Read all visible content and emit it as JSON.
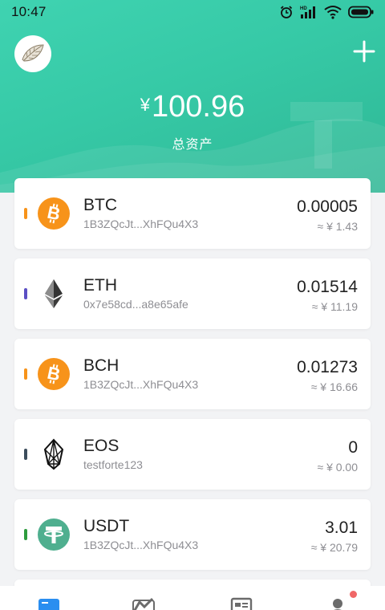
{
  "status_bar": {
    "time": "10:47"
  },
  "header": {
    "currency_symbol": "¥",
    "total_amount": "100.96",
    "total_label": "总资产"
  },
  "wallets": [
    {
      "symbol": "BTC",
      "address": "1B3ZQcJt...XhFQu4X3",
      "amount": "0.00005",
      "fiat": "≈ ¥ 1.43",
      "stripe_color": "#f7931a",
      "icon": "bitcoin-icon"
    },
    {
      "symbol": "ETH",
      "address": "0x7e58cd...a8e65afe",
      "amount": "0.01514",
      "fiat": "≈ ¥ 11.19",
      "stripe_color": "#5b4fc4",
      "icon": "ethereum-icon"
    },
    {
      "symbol": "BCH",
      "address": "1B3ZQcJt...XhFQu4X3",
      "amount": "0.01273",
      "fiat": "≈ ¥ 16.66",
      "stripe_color": "#f7931a",
      "icon": "bitcoin-cash-icon"
    },
    {
      "symbol": "EOS",
      "address": "testforte123",
      "amount": "0",
      "fiat": "≈ ¥ 0.00",
      "stripe_color": "#3c4d5c",
      "icon": "eos-icon"
    },
    {
      "symbol": "USDT",
      "address": "1B3ZQcJt...XhFQu4X3",
      "amount": "3.01",
      "fiat": "≈ ¥ 20.79",
      "stripe_color": "#2e9c3e",
      "icon": "tether-icon"
    }
  ],
  "colors": {
    "header_green": "#36c9a6",
    "notify_dot": "#f06767",
    "active_tab": "#2a8ef0"
  },
  "tabbar": {
    "items": [
      "wallet-icon",
      "market-icon",
      "news-icon",
      "profile-icon"
    ]
  }
}
